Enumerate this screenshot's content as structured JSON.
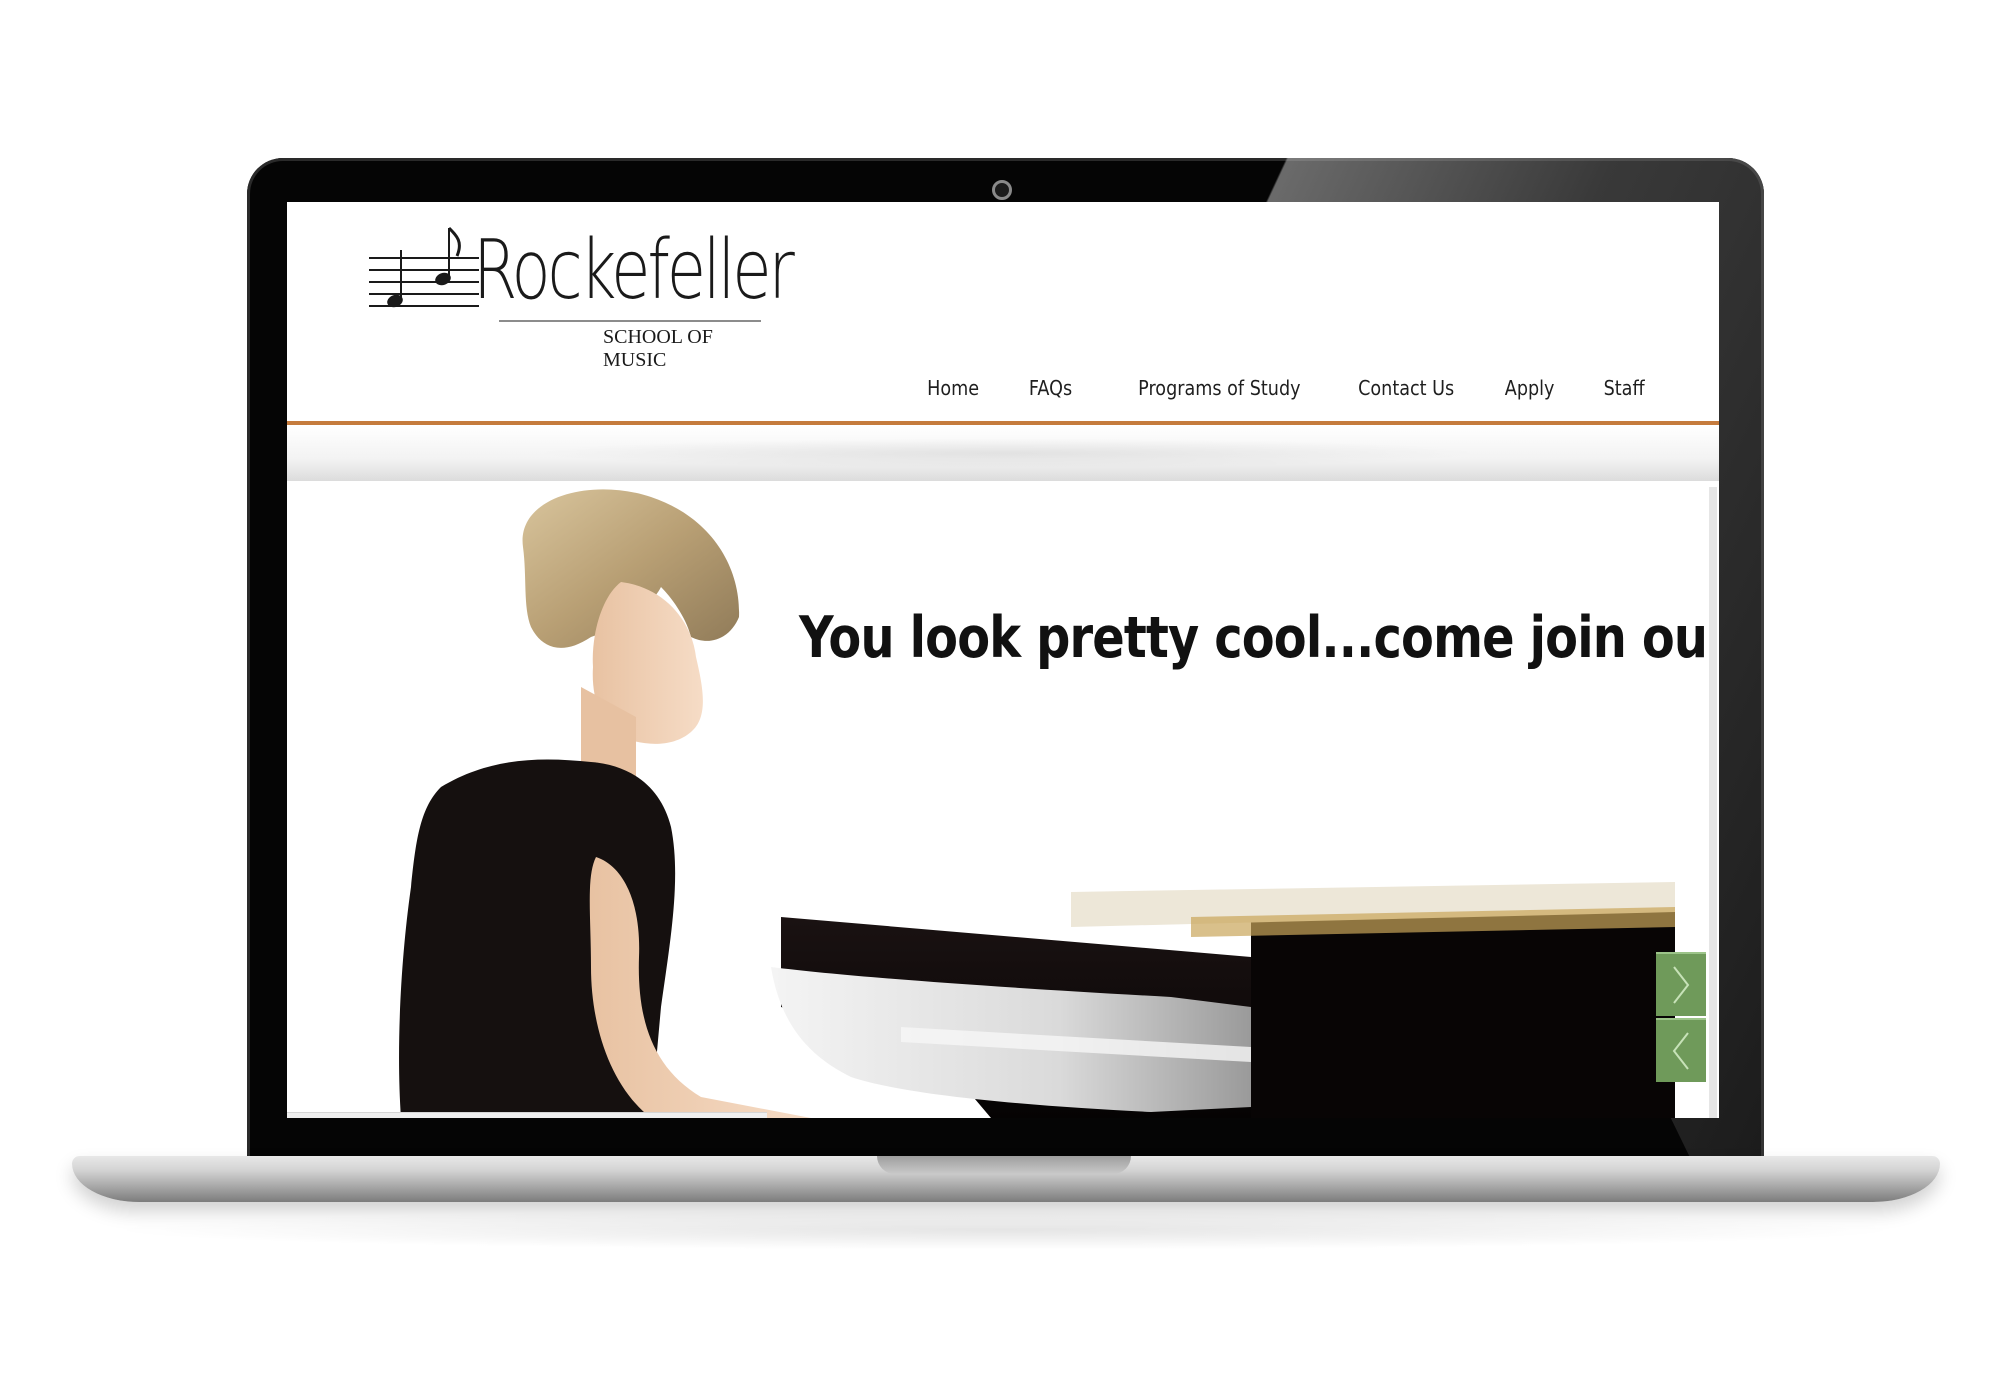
{
  "site": {
    "logo": {
      "name": "Rockefeller",
      "tagline": "SCHOOL OF MUSIC"
    },
    "nav": {
      "items": [
        {
          "label": "Home"
        },
        {
          "label": "FAQs"
        },
        {
          "label": "Programs of Study"
        },
        {
          "label": "Contact Us"
        },
        {
          "label": "Apply"
        },
        {
          "label": "Staff"
        }
      ]
    },
    "hero": {
      "headline": "You look pretty cool...come join our team",
      "image": "woman-playing-grand-piano",
      "next_icon": "chevron-right-icon",
      "prev_icon": "chevron-left-icon"
    }
  },
  "colors": {
    "accent_rule": "#c57b3d",
    "slider_button": "#6f9a5a",
    "laptop_bezel": "#050505",
    "laptop_base": "#c8c8c8"
  }
}
